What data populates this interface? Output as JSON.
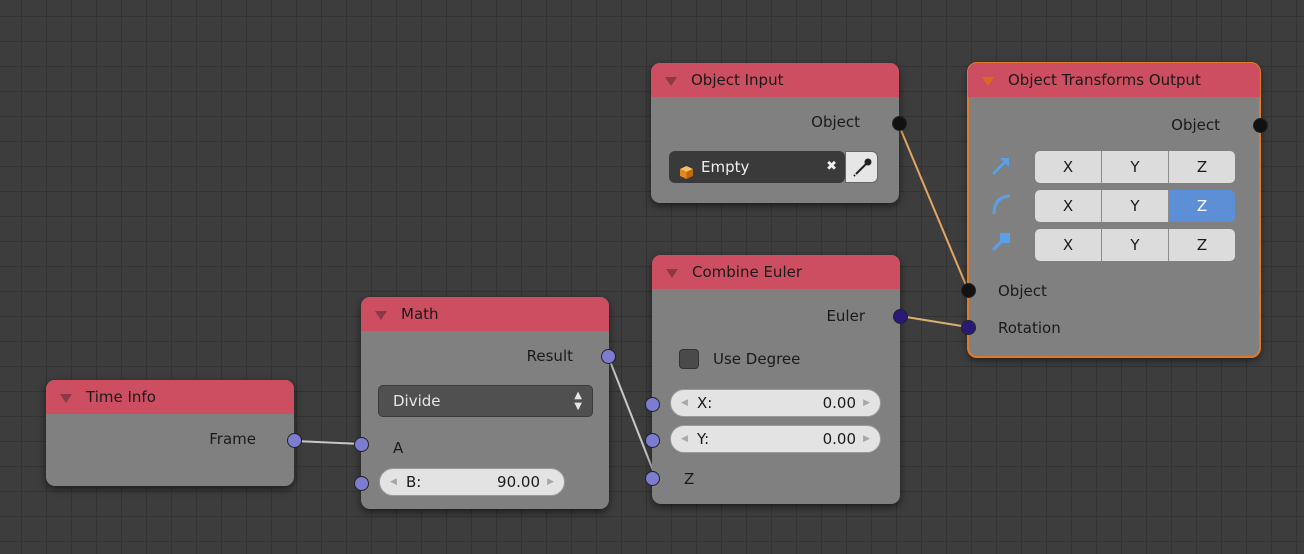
{
  "nodes": {
    "time_info": {
      "title": "Time Info",
      "outputs": {
        "frame": "Frame"
      }
    },
    "math": {
      "title": "Math",
      "outputs": {
        "result": "Result"
      },
      "operation": "Divide",
      "inputs": {
        "a": "A",
        "b_label": "B:",
        "b_value": "90.00"
      }
    },
    "object_input": {
      "title": "Object Input",
      "outputs": {
        "object": "Object"
      },
      "object_value": "Empty",
      "clear_glyph": "✖",
      "icons": [
        "object-cube-icon",
        "eyedropper-icon"
      ]
    },
    "combine_euler": {
      "title": "Combine Euler",
      "outputs": {
        "euler": "Euler"
      },
      "use_degree_label": "Use Degree",
      "use_degree_checked": false,
      "inputs": {
        "x_label": "X:",
        "x_value": "0.00",
        "y_label": "Y:",
        "y_value": "0.00",
        "z": "Z"
      }
    },
    "object_transforms_output": {
      "title": "Object Transforms Output",
      "outputs": {
        "object": "Object"
      },
      "rows": [
        {
          "icon": "location-arrow-icon",
          "x": "X",
          "y": "Y",
          "z": "Z",
          "active": []
        },
        {
          "icon": "rotation-arc-icon",
          "x": "X",
          "y": "Y",
          "z": "Z",
          "active": [
            "z"
          ]
        },
        {
          "icon": "scale-arrow-icon",
          "x": "X",
          "y": "Y",
          "z": "Z",
          "active": []
        }
      ],
      "inputs": {
        "object": "Object",
        "rotation": "Rotation"
      }
    }
  },
  "colors": {
    "header": "#cd4e60",
    "node_body": "#808080",
    "active_outline": "#e07a28",
    "axis_active": "#5d8fd6",
    "socket_object": "#111111",
    "socket_float": "#7c7cd0",
    "socket_rotation": "#2a1a78",
    "wire_object": "#e0a860"
  }
}
